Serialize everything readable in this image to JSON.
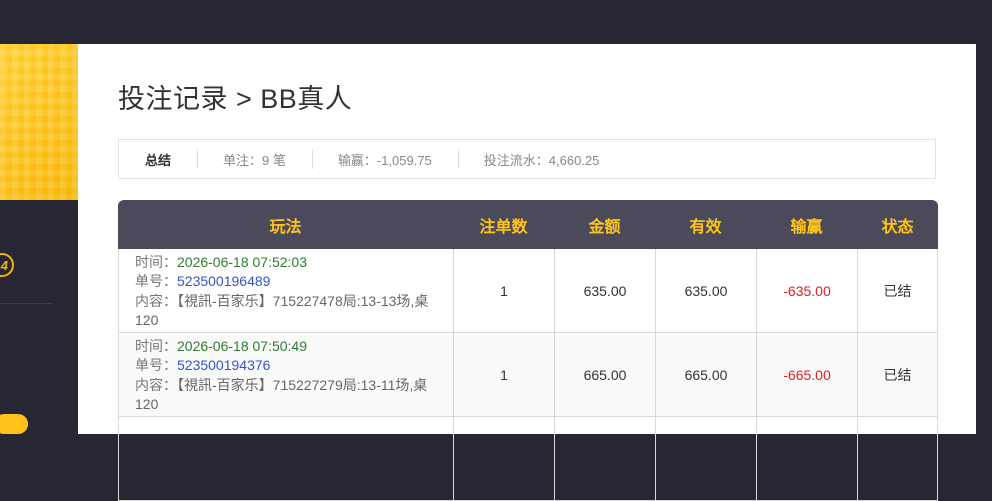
{
  "header": {
    "title": "投注记录 > BB真人"
  },
  "summary": {
    "label": "总结",
    "count": "单注：9 笔",
    "profit": "输赢：-1,059.75",
    "turnover": "投注流水：4,660.25"
  },
  "table": {
    "columns": [
      "玩法",
      "注单数",
      "金额",
      "有效",
      "输赢",
      "状态"
    ],
    "rows": [
      {
        "time_label": "时间：",
        "time": "2026-06-18 07:52:03",
        "order_label": "单号：",
        "order": "523500196489",
        "content_label": "内容：",
        "content": "【視訊-百家乐】715227478局:13-13场,桌120",
        "count": "1",
        "amount": "635.00",
        "valid": "635.00",
        "result": "-635.00",
        "status": "已结"
      },
      {
        "time_label": "时间：",
        "time": "2026-06-18 07:50:49",
        "order_label": "单号：",
        "order": "523500194376",
        "content_label": "内容：",
        "content": "【視訊-百家乐】715227279局:13-11场,桌120",
        "count": "1",
        "amount": "665.00",
        "valid": "665.00",
        "result": "-665.00",
        "status": "已结"
      }
    ]
  },
  "colors": {
    "header_bg": "#4a4a5a",
    "header_text": "#ffc41a",
    "negative": "#e02020",
    "time": "#2e7d32",
    "order": "#3355cc"
  }
}
